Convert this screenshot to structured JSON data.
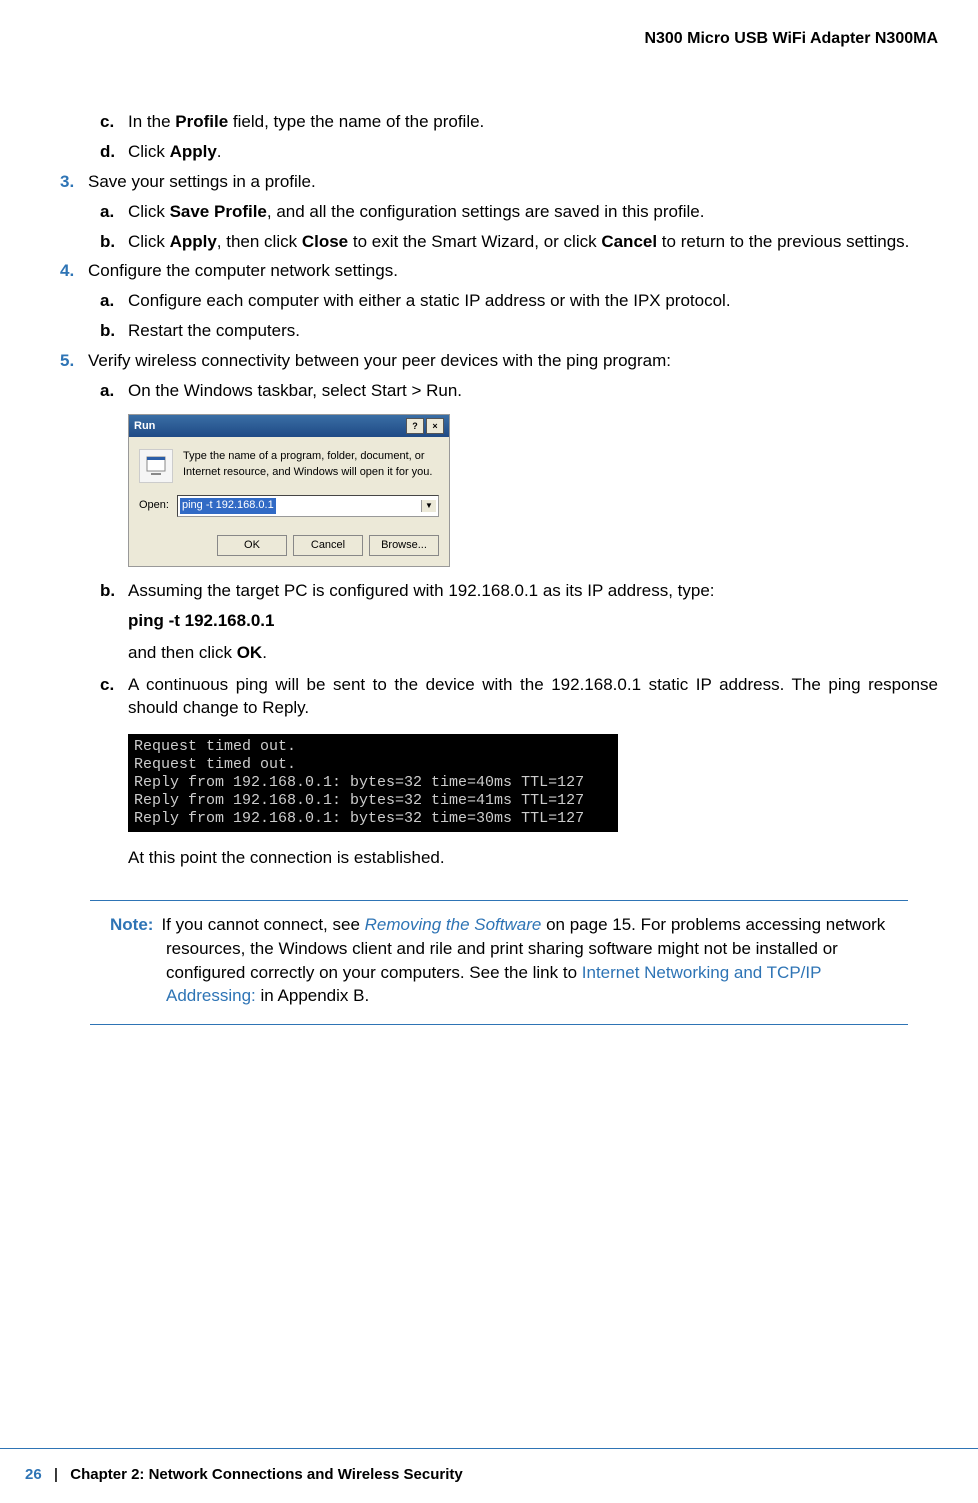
{
  "header": "N300 Micro USB WiFi Adapter N300MA",
  "items": {
    "c1_marker": "c.",
    "c1_pre": "In the ",
    "c1_bold": "Profile",
    "c1_post": " field, type the name of the profile.",
    "d1_marker": "d.",
    "d1_pre": "Click ",
    "d1_bold": "Apply",
    "d1_post": ".",
    "s3_marker": "3.",
    "s3_text": "Save your settings in a profile.",
    "s3a_marker": "a.",
    "s3a_pre": "Click ",
    "s3a_bold": "Save Profile",
    "s3a_post": ", and all the configuration settings are saved in this profile.",
    "s3b_marker": "b.",
    "s3b_pre": "Click ",
    "s3b_b1": "Apply",
    "s3b_mid1": ", then click ",
    "s3b_b2": "Close",
    "s3b_mid2": " to exit the Smart Wizard, or click ",
    "s3b_b3": "Cancel",
    "s3b_post": " to return to the previous settings.",
    "s4_marker": "4.",
    "s4_text": "Configure the computer network settings.",
    "s4a_marker": "a.",
    "s4a_text": "Configure each computer with either a static IP address or with the IPX protocol.",
    "s4b_marker": "b.",
    "s4b_text": "Restart the computers.",
    "s5_marker": "5.",
    "s5_text": "Verify wireless connectivity between your peer devices with the ping program:",
    "s5a_marker": "a.",
    "s5a_text": "On the Windows taskbar, select Start > Run.",
    "s5b_marker": "b.",
    "s5b_text": "Assuming the target PC is configured with 192.168.0.1 as its IP address, type:",
    "s5b_cmd": "ping -t 192.168.0.1",
    "s5b_post_pre": "and then click ",
    "s5b_post_bold": "OK",
    "s5b_post_end": ".",
    "s5c_marker": "c.",
    "s5c_text": "A continuous ping will be sent to the device with the 192.168.0.1 static IP address. The ping response should change to Reply.",
    "s5c_after": "At this point the connection is established."
  },
  "run_dialog": {
    "title": "Run",
    "help_icon": "?",
    "close_icon": "×",
    "desc": "Type the name of a program, folder, document, or Internet resource, and Windows will open it for you.",
    "open_label": "Open:",
    "input_value": "ping -t 192.168.0.1",
    "btn_ok": "OK",
    "btn_cancel": "Cancel",
    "btn_browse": "Browse..."
  },
  "terminal": "Request timed out.\nRequest timed out.\nReply from 192.168.0.1: bytes=32 time=40ms TTL=127\nReply from 192.168.0.1: bytes=32 time=41ms TTL=127\nReply from 192.168.0.1: bytes=32 time=30ms TTL=127",
  "note": {
    "label": "Note:",
    "part1": "If you cannot connect, see ",
    "link1": "Removing the Software",
    "part2": " on page 15. For problems accessing network resources, the Windows client and rile and print sharing software might not be installed or configured correctly on your computers. See the link to ",
    "link2": "Internet Networking and TCP/IP Addressing:",
    "part3": " in Appendix B."
  },
  "footer": {
    "page": "26",
    "sep": "|",
    "chapter": "Chapter 2:  Network Connections and Wireless Security"
  }
}
